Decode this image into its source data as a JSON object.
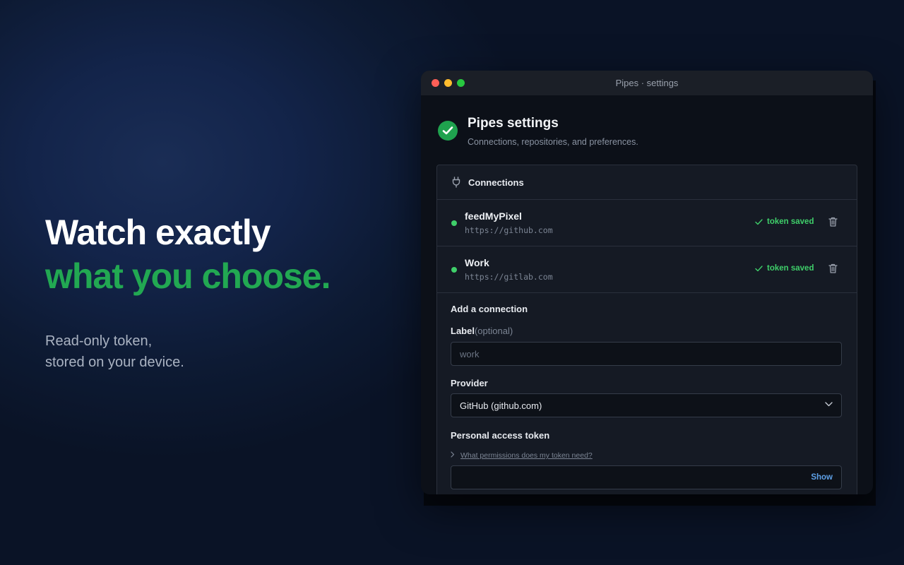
{
  "hero": {
    "line1": "Watch exactly",
    "line2": "what you choose.",
    "sub_line1": "Read-only token,",
    "sub_line2": "stored on your device."
  },
  "window": {
    "title": "Pipes · settings"
  },
  "header": {
    "title": "Pipes settings",
    "subtitle": "Connections, repositories, and preferences."
  },
  "connections": {
    "title": "Connections",
    "items": [
      {
        "name": "feedMyPixel",
        "url": "https://github.com",
        "status": "token saved"
      },
      {
        "name": "Work",
        "url": "https://gitlab.com",
        "status": "token saved"
      }
    ]
  },
  "add_connection": {
    "title": "Add a connection",
    "label_field": {
      "label": "Label",
      "optional": "(optional)",
      "placeholder": "work"
    },
    "provider_field": {
      "label": "Provider",
      "value": "GitHub (github.com)"
    },
    "token_field": {
      "label": "Personal access token",
      "help": "What permissions does my token need?",
      "show": "Show"
    }
  },
  "colors": {
    "accent_green": "#22a852",
    "status_green": "#3fcf6a",
    "link_blue": "#5ea1e8"
  }
}
